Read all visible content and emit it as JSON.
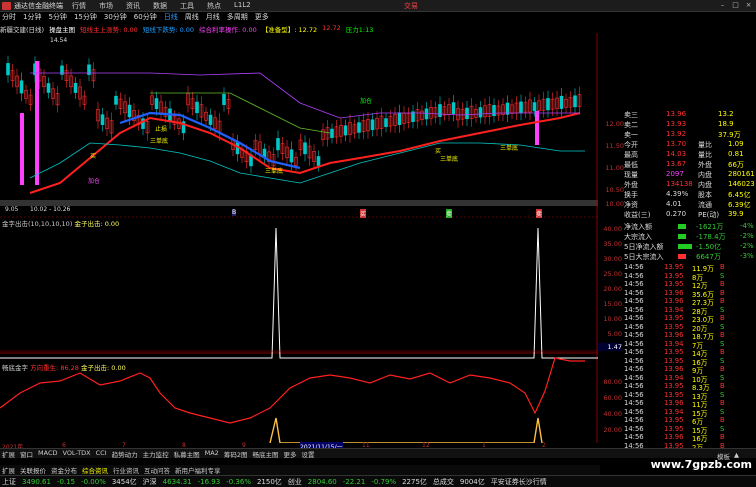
{
  "window": {
    "title": "通达信金融终端",
    "menus": [
      "行情",
      "市场",
      "资讯",
      "数据",
      "工具",
      "热点",
      "L1L2"
    ],
    "trade_label": "交易"
  },
  "period_tabs": [
    "分时",
    "1分钟",
    "5分钟",
    "15分钟",
    "30分钟",
    "60分钟",
    "日线",
    "周线",
    "月线",
    "多周期",
    "更多"
  ],
  "active_period": "日线",
  "indicator_line": {
    "stock": "新疆交建(日线)",
    "items": [
      {
        "text": "操盘主图",
        "color": "#ffffff"
      },
      {
        "text": "短线主上涨势: 0.00",
        "color": "#ff3030"
      },
      {
        "text": "短线下跌势: 0.00",
        "color": "#1ea0ff"
      },
      {
        "text": "综合利率操作: 0.00",
        "color": "#ff40ff"
      },
      {
        "text": "【准备型】: 12.72",
        "color": "#ffff00"
      },
      {
        "text": "12.72",
        "color": "#ff3030"
      },
      {
        "text": "压力1:13",
        "color": "#00ff00"
      }
    ]
  },
  "main_chart": {
    "price_labels": [
      "14.54",
      "9.05",
      "10.02 - 10.26"
    ],
    "annotations": [
      "买",
      "买",
      "三单底",
      "三单底",
      "三单底",
      "三单底",
      "加仓",
      "止损",
      "加仓"
    ],
    "y_ticks": [
      "12.00",
      "11.50",
      "11.00",
      "10.50",
      "10.00"
    ]
  },
  "sub_chart_1": {
    "title": "金字出击(10,10,10,10)",
    "value_label": "金子出击: 0.00",
    "y_ticks": [
      "40.00",
      "35.00",
      "30.00",
      "25.00",
      "20.00",
      "15.00",
      "10.00",
      "5.00",
      "1.47"
    ],
    "x_markers": [
      "B",
      "买",
      "卖",
      "卖"
    ]
  },
  "sub_chart_2": {
    "title": "畅底金字",
    "label_a": "方向重生: 86.28",
    "label_b": "金子出击: 0.00",
    "y_ticks": [
      "80.00",
      "60.00",
      "40.00",
      "20.00"
    ]
  },
  "date_axis": {
    "labels": [
      "2021年",
      "6",
      "7",
      "8",
      "9",
      "10",
      "11",
      "12",
      "1",
      "2"
    ],
    "highlight": "2021/11/15/一"
  },
  "quote_panel": {
    "sell": [
      {
        "label": "卖三",
        "price": "13.96",
        "vol": "13.2",
        "color": "#ff3030"
      },
      {
        "label": "卖二",
        "price": "13.93",
        "vol": "18.9",
        "color": "#ff3030"
      },
      {
        "label": "卖一",
        "price": "13.92",
        "vol": "37.9万",
        "color": "#ff3030"
      }
    ],
    "stats": [
      {
        "l1": "今开",
        "v1": "13.70",
        "l2": "量比",
        "v2": "1.09"
      },
      {
        "l1": "最高",
        "v1": "14.03",
        "l2": "量比",
        "v2": "0.81"
      },
      {
        "l1": "最低",
        "v1": "13.67",
        "l2": "外盘",
        "v2": "66万"
      },
      {
        "l1": "现量",
        "v1": "2097",
        "l2": "内盘",
        "v2": "280161"
      },
      {
        "l1": "外盘",
        "v1": "134138",
        "l2": "内盘",
        "v2": "146023"
      },
      {
        "l1": "换手",
        "v1": "4.39%",
        "l2": "股本",
        "v2": "6.45亿"
      },
      {
        "l1": "净资",
        "v1": "4.01",
        "l2": "流通",
        "v2": "6.39亿"
      },
      {
        "l1": "收益(三)",
        "v1": "0.270",
        "l2": "PE(动)",
        "v2": "39.9"
      }
    ],
    "flow": [
      {
        "label": "净流入额",
        "value": "-1621万",
        "pct": "-4%"
      },
      {
        "label": "大宗流入",
        "value": "-178.4万",
        "pct": "-2%"
      },
      {
        "label": "5日净流入额",
        "value": "-1.50亿",
        "pct": "-2%"
      },
      {
        "label": "5日大宗流入",
        "value": "6647万",
        "pct": "-3%"
      }
    ],
    "ticks": [
      {
        "t": "14:56",
        "p": "13.95",
        "v": "11.9万",
        "s": "B"
      },
      {
        "t": "14:56",
        "p": "13.95",
        "v": "8万",
        "s": "S"
      },
      {
        "t": "14:56",
        "p": "13.95",
        "v": "12万",
        "s": "B"
      },
      {
        "t": "14:56",
        "p": "13.96",
        "v": "35.6万",
        "s": "B"
      },
      {
        "t": "14:56",
        "p": "13.96",
        "v": "27.3万",
        "s": "B"
      },
      {
        "t": "14:56",
        "p": "13.94",
        "v": "28万",
        "s": "S"
      },
      {
        "t": "14:56",
        "p": "13.95",
        "v": "23.0万",
        "s": "B"
      },
      {
        "t": "14:56",
        "p": "13.95",
        "v": "20万",
        "s": "S"
      },
      {
        "t": "14:56",
        "p": "13.96",
        "v": "18.7万",
        "s": "B"
      },
      {
        "t": "14:56",
        "p": "13.94",
        "v": "7万",
        "s": "S"
      },
      {
        "t": "14:56",
        "p": "13.95",
        "v": "14万",
        "s": "B"
      },
      {
        "t": "14:56",
        "p": "13.95",
        "v": "16万",
        "s": "S"
      },
      {
        "t": "14:56",
        "p": "13.96",
        "v": "9万",
        "s": "B"
      },
      {
        "t": "14:56",
        "p": "13.94",
        "v": "10万",
        "s": "S"
      },
      {
        "t": "14:56",
        "p": "13.95",
        "v": "8.3万",
        "s": "B"
      },
      {
        "t": "14:56",
        "p": "13.95",
        "v": "13万",
        "s": "S"
      },
      {
        "t": "14:56",
        "p": "13.96",
        "v": "11万",
        "s": "B"
      },
      {
        "t": "14:56",
        "p": "13.94",
        "v": "15万",
        "s": "S"
      },
      {
        "t": "14:56",
        "p": "13.95",
        "v": "6万",
        "s": "B"
      },
      {
        "t": "14:56",
        "p": "13.95",
        "v": "15万",
        "s": "S"
      },
      {
        "t": "14:56",
        "p": "13.96",
        "v": "16万",
        "s": "B"
      },
      {
        "t": "14:56",
        "p": "13.95",
        "v": "2万",
        "s": "B"
      }
    ]
  },
  "bottom_tabs": [
    "扩展",
    "窗口",
    "MACD",
    "VOL-TDX",
    "CCI",
    "趋势动力",
    "主力监控",
    "私募主图",
    "MA2",
    "筹码2图",
    "畅底主图",
    "更多",
    "设置"
  ],
  "bottom_tabs2": [
    "扩展",
    "关联报价",
    "资金分布",
    "综合资讯",
    "行业资讯",
    "互动问答",
    "新用户福利专享"
  ],
  "extra_tabs": [
    "模板",
    "▲"
  ],
  "status": {
    "items": [
      {
        "name": "上证",
        "val": "3490.61",
        "chg": "-0.15",
        "pct": "-0.00%",
        "amt": "3454亿"
      },
      {
        "name": "沪深",
        "val": "4634.31",
        "chg": "-16.93",
        "pct": "-0.36%",
        "amt": "2150亿"
      },
      {
        "name": "创业",
        "val": "2804.60",
        "chg": "-22.21",
        "pct": "-0.79%",
        "amt": "2275亿"
      }
    ],
    "total_label": "总成交",
    "total_value": "9004亿",
    "broker": "平安证券长沙行情"
  },
  "watermark": "www.7gpzb.com"
}
